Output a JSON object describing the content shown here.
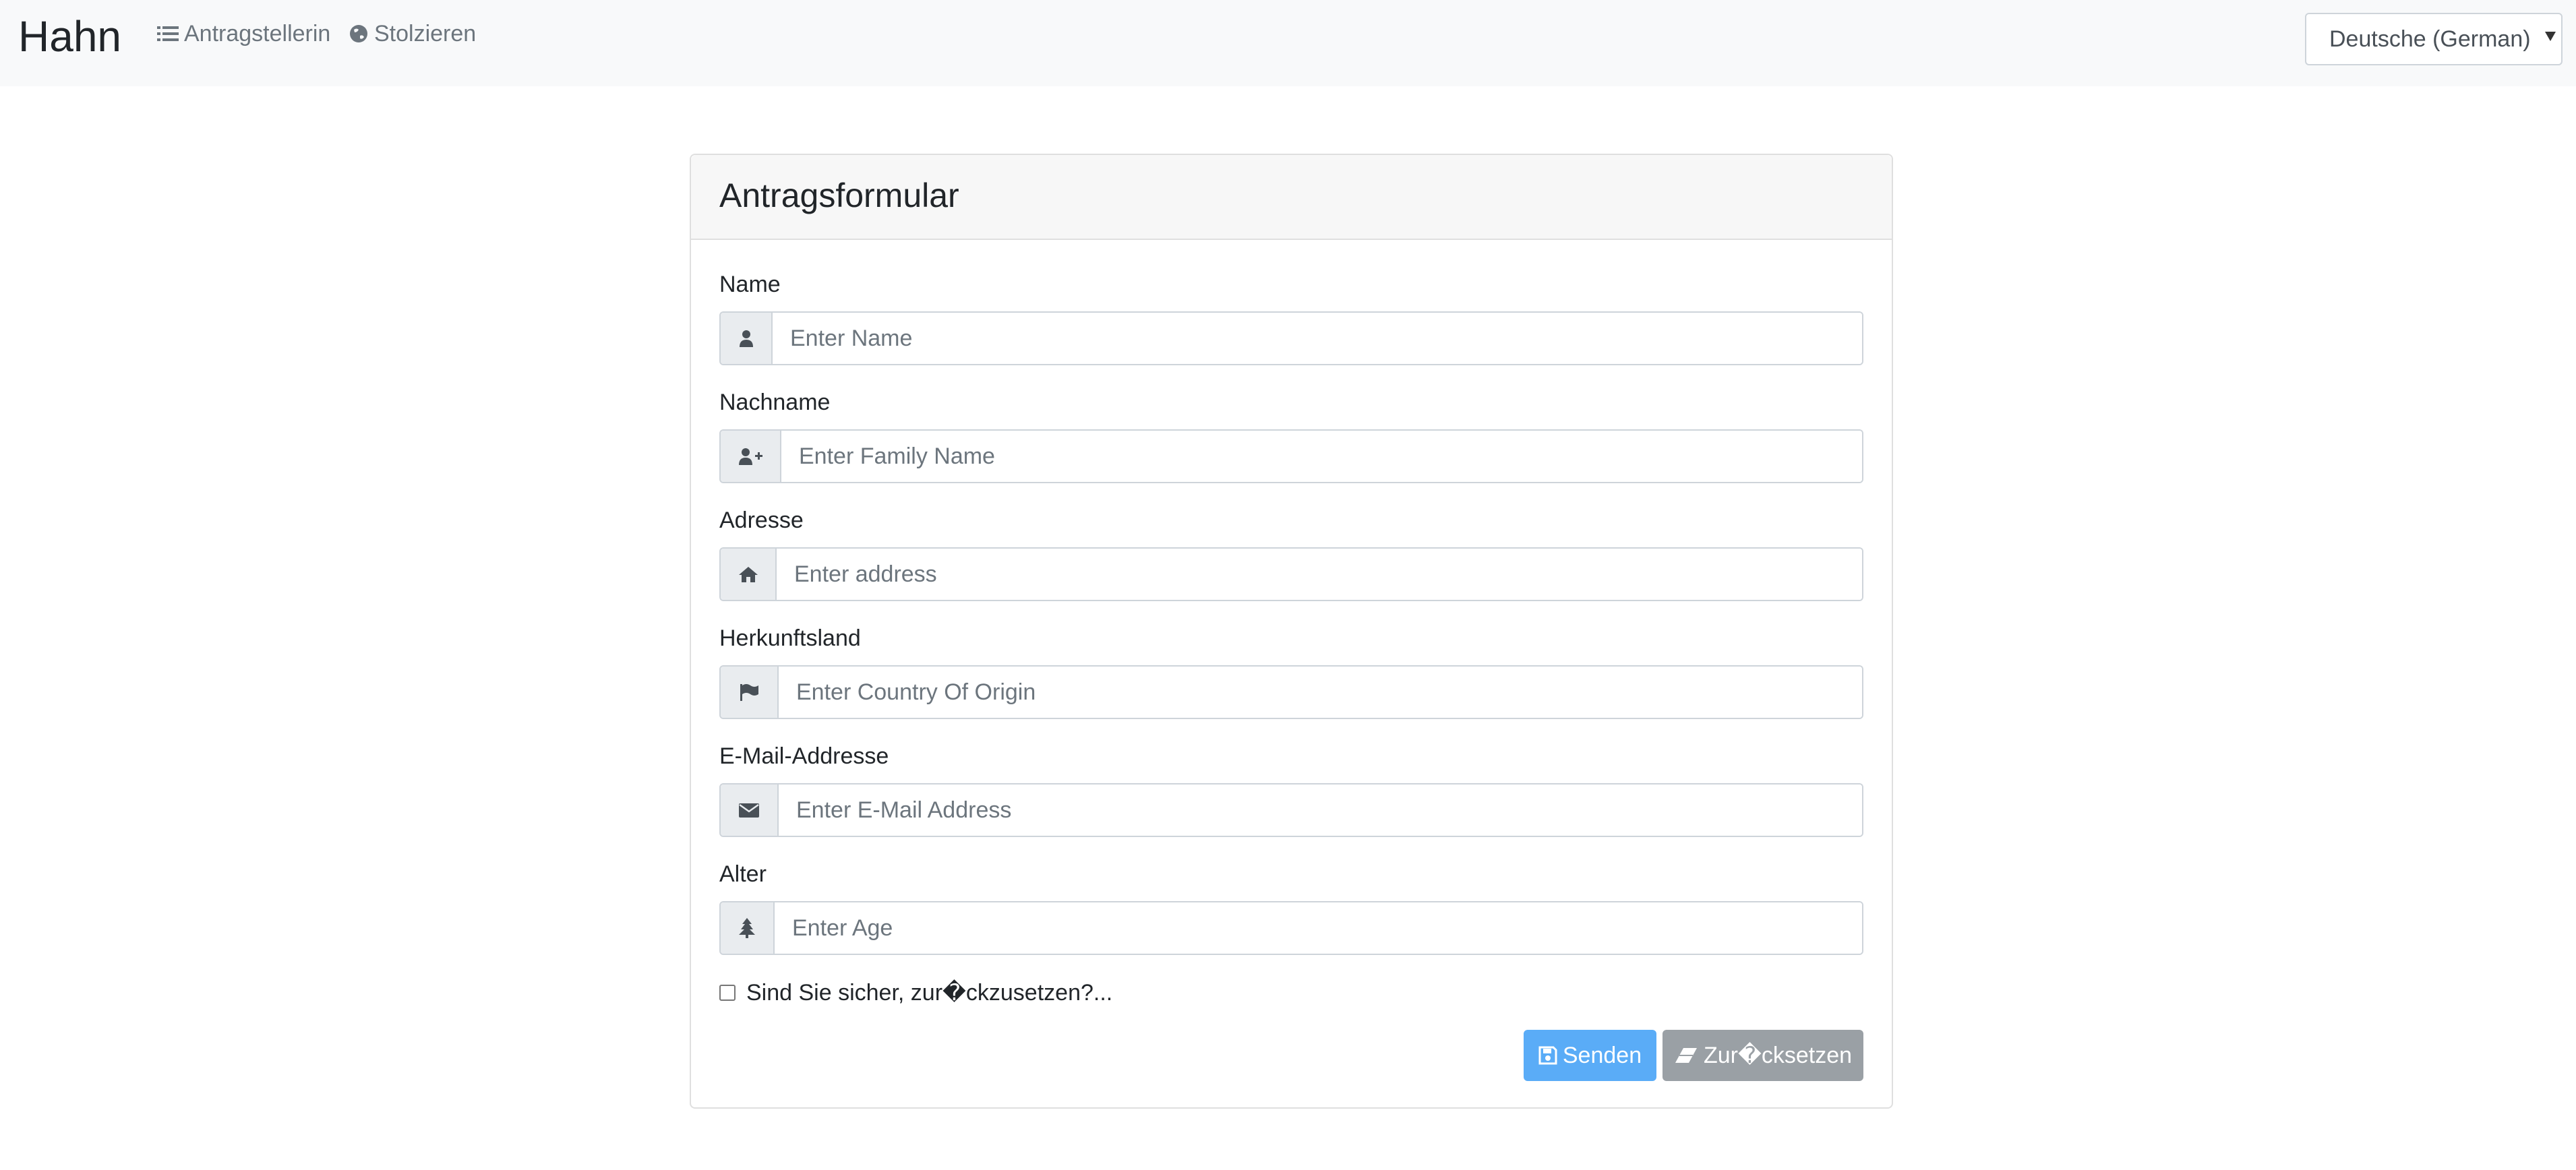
{
  "navbar": {
    "brand": "Hahn",
    "links": [
      {
        "label": "Antragstellerin",
        "icon": "list-icon"
      },
      {
        "label": "Stolzieren",
        "icon": "globe-icon"
      }
    ],
    "language": "Deutsche (German)"
  },
  "form": {
    "title": "Antragsformular",
    "fields": [
      {
        "label": "Name",
        "placeholder": "Enter Name",
        "icon": "user-icon"
      },
      {
        "label": "Nachname",
        "placeholder": "Enter Family Name",
        "icon": "user-plus-icon"
      },
      {
        "label": "Adresse",
        "placeholder": "Enter address",
        "icon": "home-icon"
      },
      {
        "label": "Herkunftsland",
        "placeholder": "Enter Country Of Origin",
        "icon": "flag-icon"
      },
      {
        "label": "E-Mail-Addresse",
        "placeholder": "Enter E-Mail Address",
        "icon": "envelope-icon"
      },
      {
        "label": "Alter",
        "placeholder": "Enter Age",
        "icon": "tree-icon"
      }
    ],
    "checkbox_label": "Sind Sie sicher, zur�ckzusetzen?...",
    "send_label": "Senden",
    "reset_label": "Zur�cksetzen"
  },
  "colors": {
    "send_button": "#5aacf7",
    "reset_button": "#9aa0a5",
    "navbar_bg": "#f8f9fa"
  }
}
